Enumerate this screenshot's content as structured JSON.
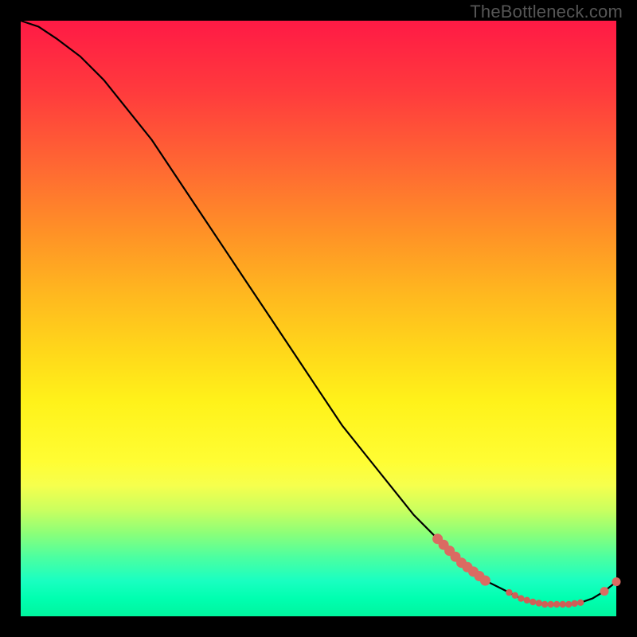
{
  "watermark": "TheBottleneck.com",
  "colors": {
    "dot": "#da6b62",
    "curve": "#000000"
  },
  "chart_data": {
    "type": "line",
    "title": "",
    "xlabel": "",
    "ylabel": "",
    "xlim": [
      0,
      100
    ],
    "ylim": [
      0,
      100
    ],
    "grid": false,
    "series": [
      {
        "name": "bottleneck-curve",
        "x": [
          0,
          3,
          6,
          10,
          14,
          18,
          22,
          26,
          30,
          34,
          38,
          42,
          46,
          50,
          54,
          58,
          62,
          66,
          70,
          74,
          78,
          82,
          84,
          86,
          88,
          90,
          92,
          94,
          96,
          98,
          100
        ],
        "y": [
          100,
          99,
          97,
          94,
          90,
          85,
          80,
          74,
          68,
          62,
          56,
          50,
          44,
          38,
          32,
          27,
          22,
          17,
          13,
          9,
          6,
          4,
          3,
          2.4,
          2,
          2,
          2,
          2.3,
          3,
          4.2,
          5.8
        ]
      }
    ],
    "markers": {
      "evident_segment_x": [
        70,
        71,
        72,
        73,
        74,
        75,
        76,
        77,
        78
      ],
      "baseline_segment_x": [
        82,
        83,
        84,
        85,
        86,
        87,
        88,
        89,
        90,
        91,
        92,
        93,
        94
      ],
      "tail_points_x": [
        98,
        100
      ]
    }
  }
}
